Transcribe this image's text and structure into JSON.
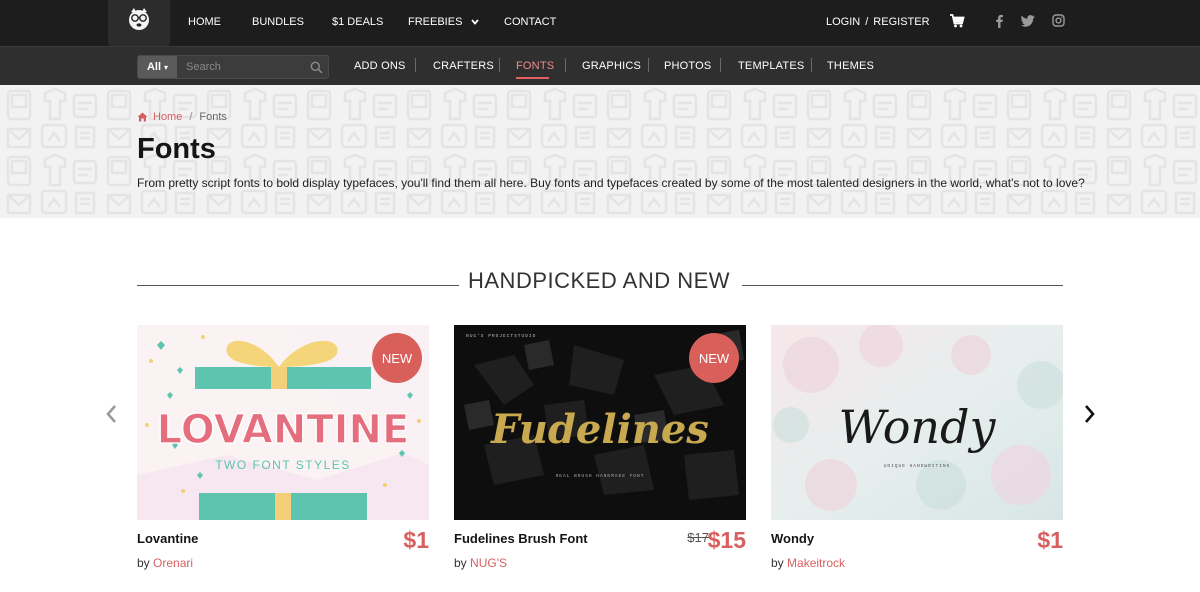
{
  "nav": {
    "home": "HOME",
    "bundles": "BUNDLES",
    "deals": "$1 DEALS",
    "freebies": "FREEBIES",
    "contact": "CONTACT",
    "login": "LOGIN",
    "sep": "/",
    "register": "REGISTER"
  },
  "subnav": {
    "all": "All",
    "search_placeholder": "Search",
    "categories": [
      "ADD ONS",
      "CRAFTERS",
      "FONTS",
      "GRAPHICS",
      "PHOTOS",
      "TEMPLATES",
      "THEMES"
    ],
    "active": "FONTS"
  },
  "breadcrumb": {
    "home": "Home",
    "slash": "/",
    "current": "Fonts"
  },
  "page": {
    "title": "Fonts",
    "description": "From pretty script fonts to bold display typefaces, you'll find them all here. Buy fonts and typefaces created by some of the most talented designers in the world, what's not to love?"
  },
  "section": {
    "title": "HANDPICKED AND NEW"
  },
  "products": [
    {
      "name": "Lovantine",
      "by": "by",
      "author": "Orenari",
      "price": "$1",
      "badge": "NEW",
      "image_title": "LOVANTINE",
      "image_subtitle": "TWO FONT STYLES"
    },
    {
      "name": "Fudelines Brush Font",
      "by": "by",
      "author": "NUG'S",
      "price": "$15",
      "old_price": "$17",
      "badge": "NEW",
      "image_title": "Fudelines"
    },
    {
      "name": "Wondy",
      "by": "by",
      "author": "Makeitrock",
      "price": "$1",
      "image_title": "Wondy"
    }
  ],
  "colors": {
    "accent": "#d85f5f",
    "topbar": "#1d1d1d",
    "subbar": "#2f2f2f",
    "badge": "#d9605a"
  },
  "icons": [
    "logo-icon",
    "chevron-down-icon",
    "cart-icon",
    "facebook-icon",
    "twitter-icon",
    "instagram-icon",
    "search-icon",
    "home-icon",
    "arrow-left-icon",
    "arrow-right-icon"
  ]
}
